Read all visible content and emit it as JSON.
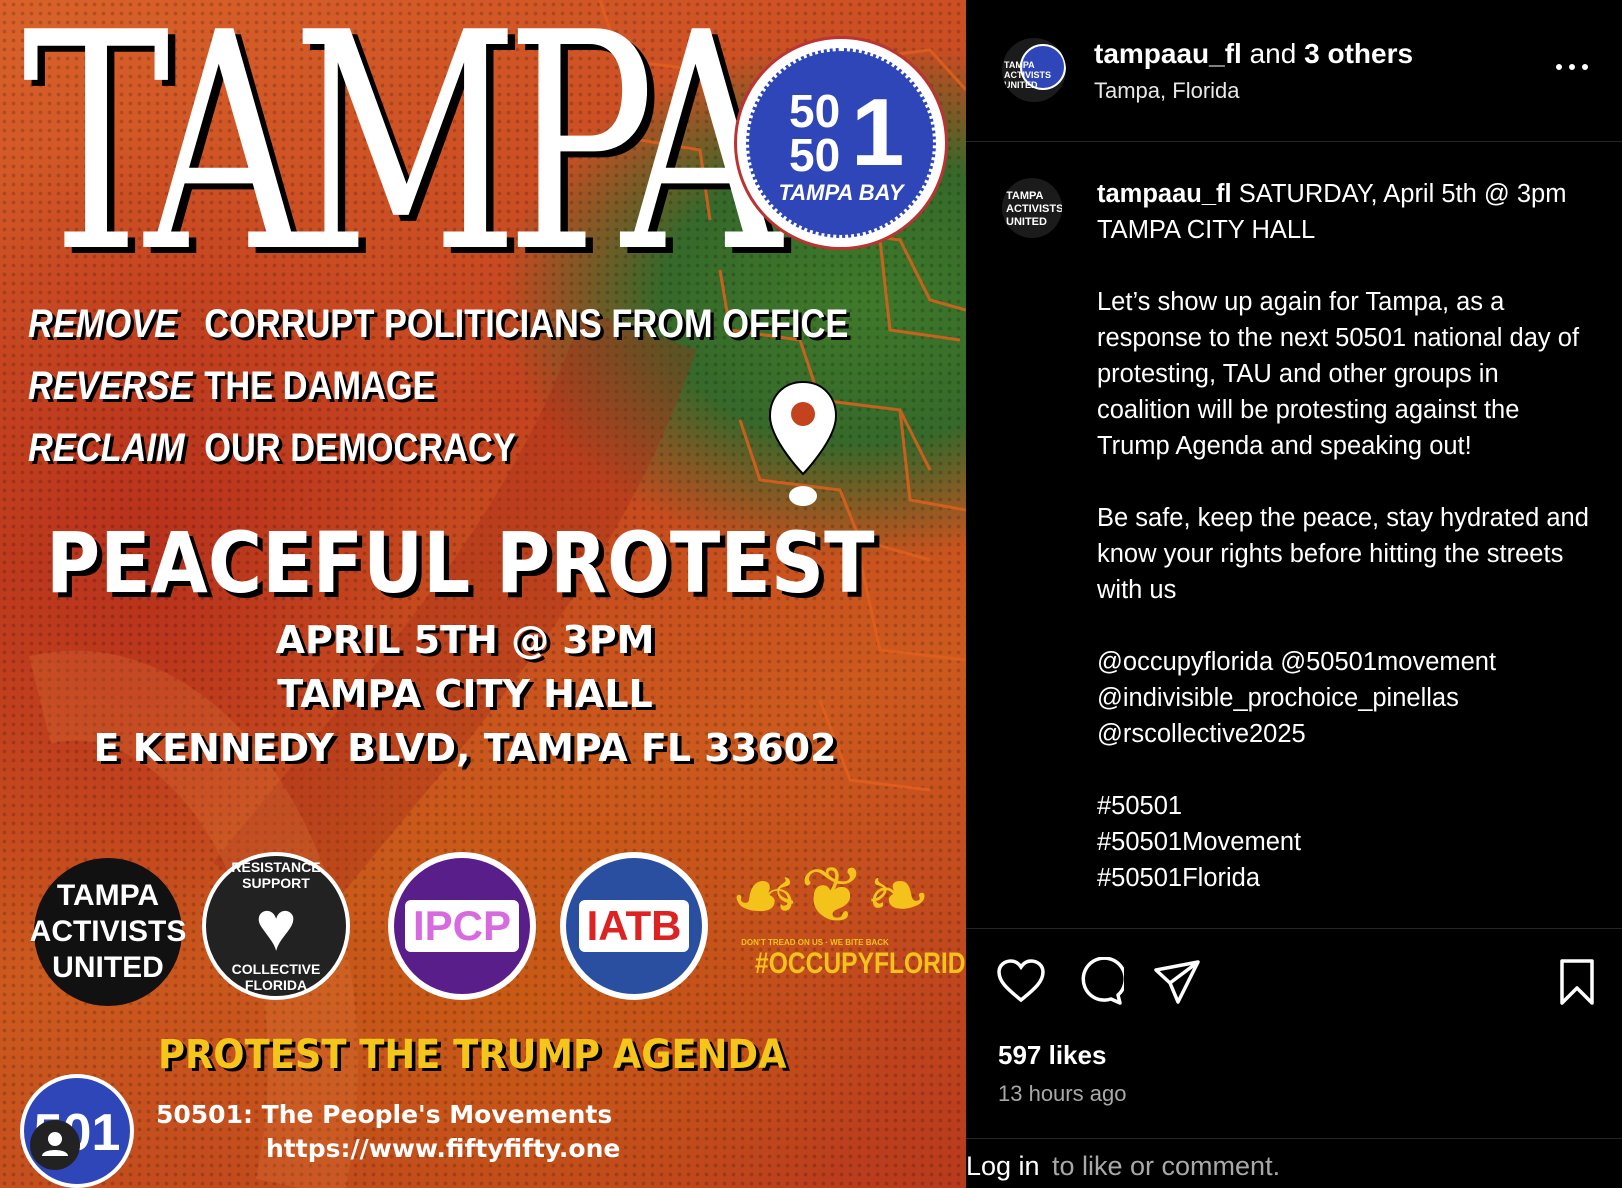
{
  "poster": {
    "title": "TAMPA",
    "badge": {
      "line1": "50",
      "line2": "50",
      "big": "1",
      "place": "TAMPA BAY"
    },
    "slogans": [
      {
        "verb": "REMOVE",
        "rest": "CORRUPT POLITICIANS FROM OFFICE"
      },
      {
        "verb": "REVERSE",
        "rest": "THE DAMAGE"
      },
      {
        "verb": "RECLAIM",
        "rest": "OUR DEMOCRACY"
      }
    ],
    "headline": "PEACEFUL PROTEST",
    "when": "APRIL 5TH @ 3PM",
    "where": "TAMPA CITY HALL",
    "address": "E KENNEDY BLVD, TAMPA FL 33602",
    "logos": {
      "tau": "TAMPA ACTIVISTS UNITED",
      "rs_top": "RESISTANCE SUPPORT",
      "rs_bottom": "COLLECTIVE FLORIDA",
      "ipcp": "IPCP",
      "iatb": "IATB",
      "occupy_small": "DON'T TREAD ON US · WE BITE BACK",
      "occupy": "#OCCUPYFLORIDA"
    },
    "call": "PROTEST THE TRUMP AGENDA",
    "small_badge": "501",
    "footer_org": "50501: The People's Movements",
    "footer_url": "https://www.fiftyfifty.one",
    "colors": {
      "orange": "#cc5a1e",
      "green": "#36692a",
      "yellow": "#f4c51a",
      "blue": "#2f46b8"
    }
  },
  "header": {
    "username": "tampaau_fl",
    "joiner": "and",
    "others": "3 others",
    "location": "Tampa, Florida",
    "more_icon": "more-horizontal-icon",
    "avatar_text": "TAMPA ACTIVISTS UNITED"
  },
  "caption": {
    "username": "tampaau_fl",
    "first_line": " SATURDAY, April 5th @ 3pm TAMPA CITY HALL",
    "paragraphs": [
      "Let’s show up again for Tampa, as a response to the next 50501 national day of protesting, TAU and other groups in coalition will be protesting against the Trump Agenda and speaking out!",
      "Be safe, keep the peace, stay hydrated and know your rights before hitting the streets with us",
      "@occupyflorida @50501movement\n@indivisible_prochoice_pinellas\n@rscollective2025",
      "#50501\n#50501Movement\n#50501Florida"
    ]
  },
  "actions": {
    "icons": [
      "heart-icon",
      "comment-icon",
      "share-icon",
      "bookmark-icon"
    ],
    "likes": "597 likes",
    "time": "13 hours ago"
  },
  "login": {
    "link": "Log in",
    "rest": "to like or comment."
  }
}
